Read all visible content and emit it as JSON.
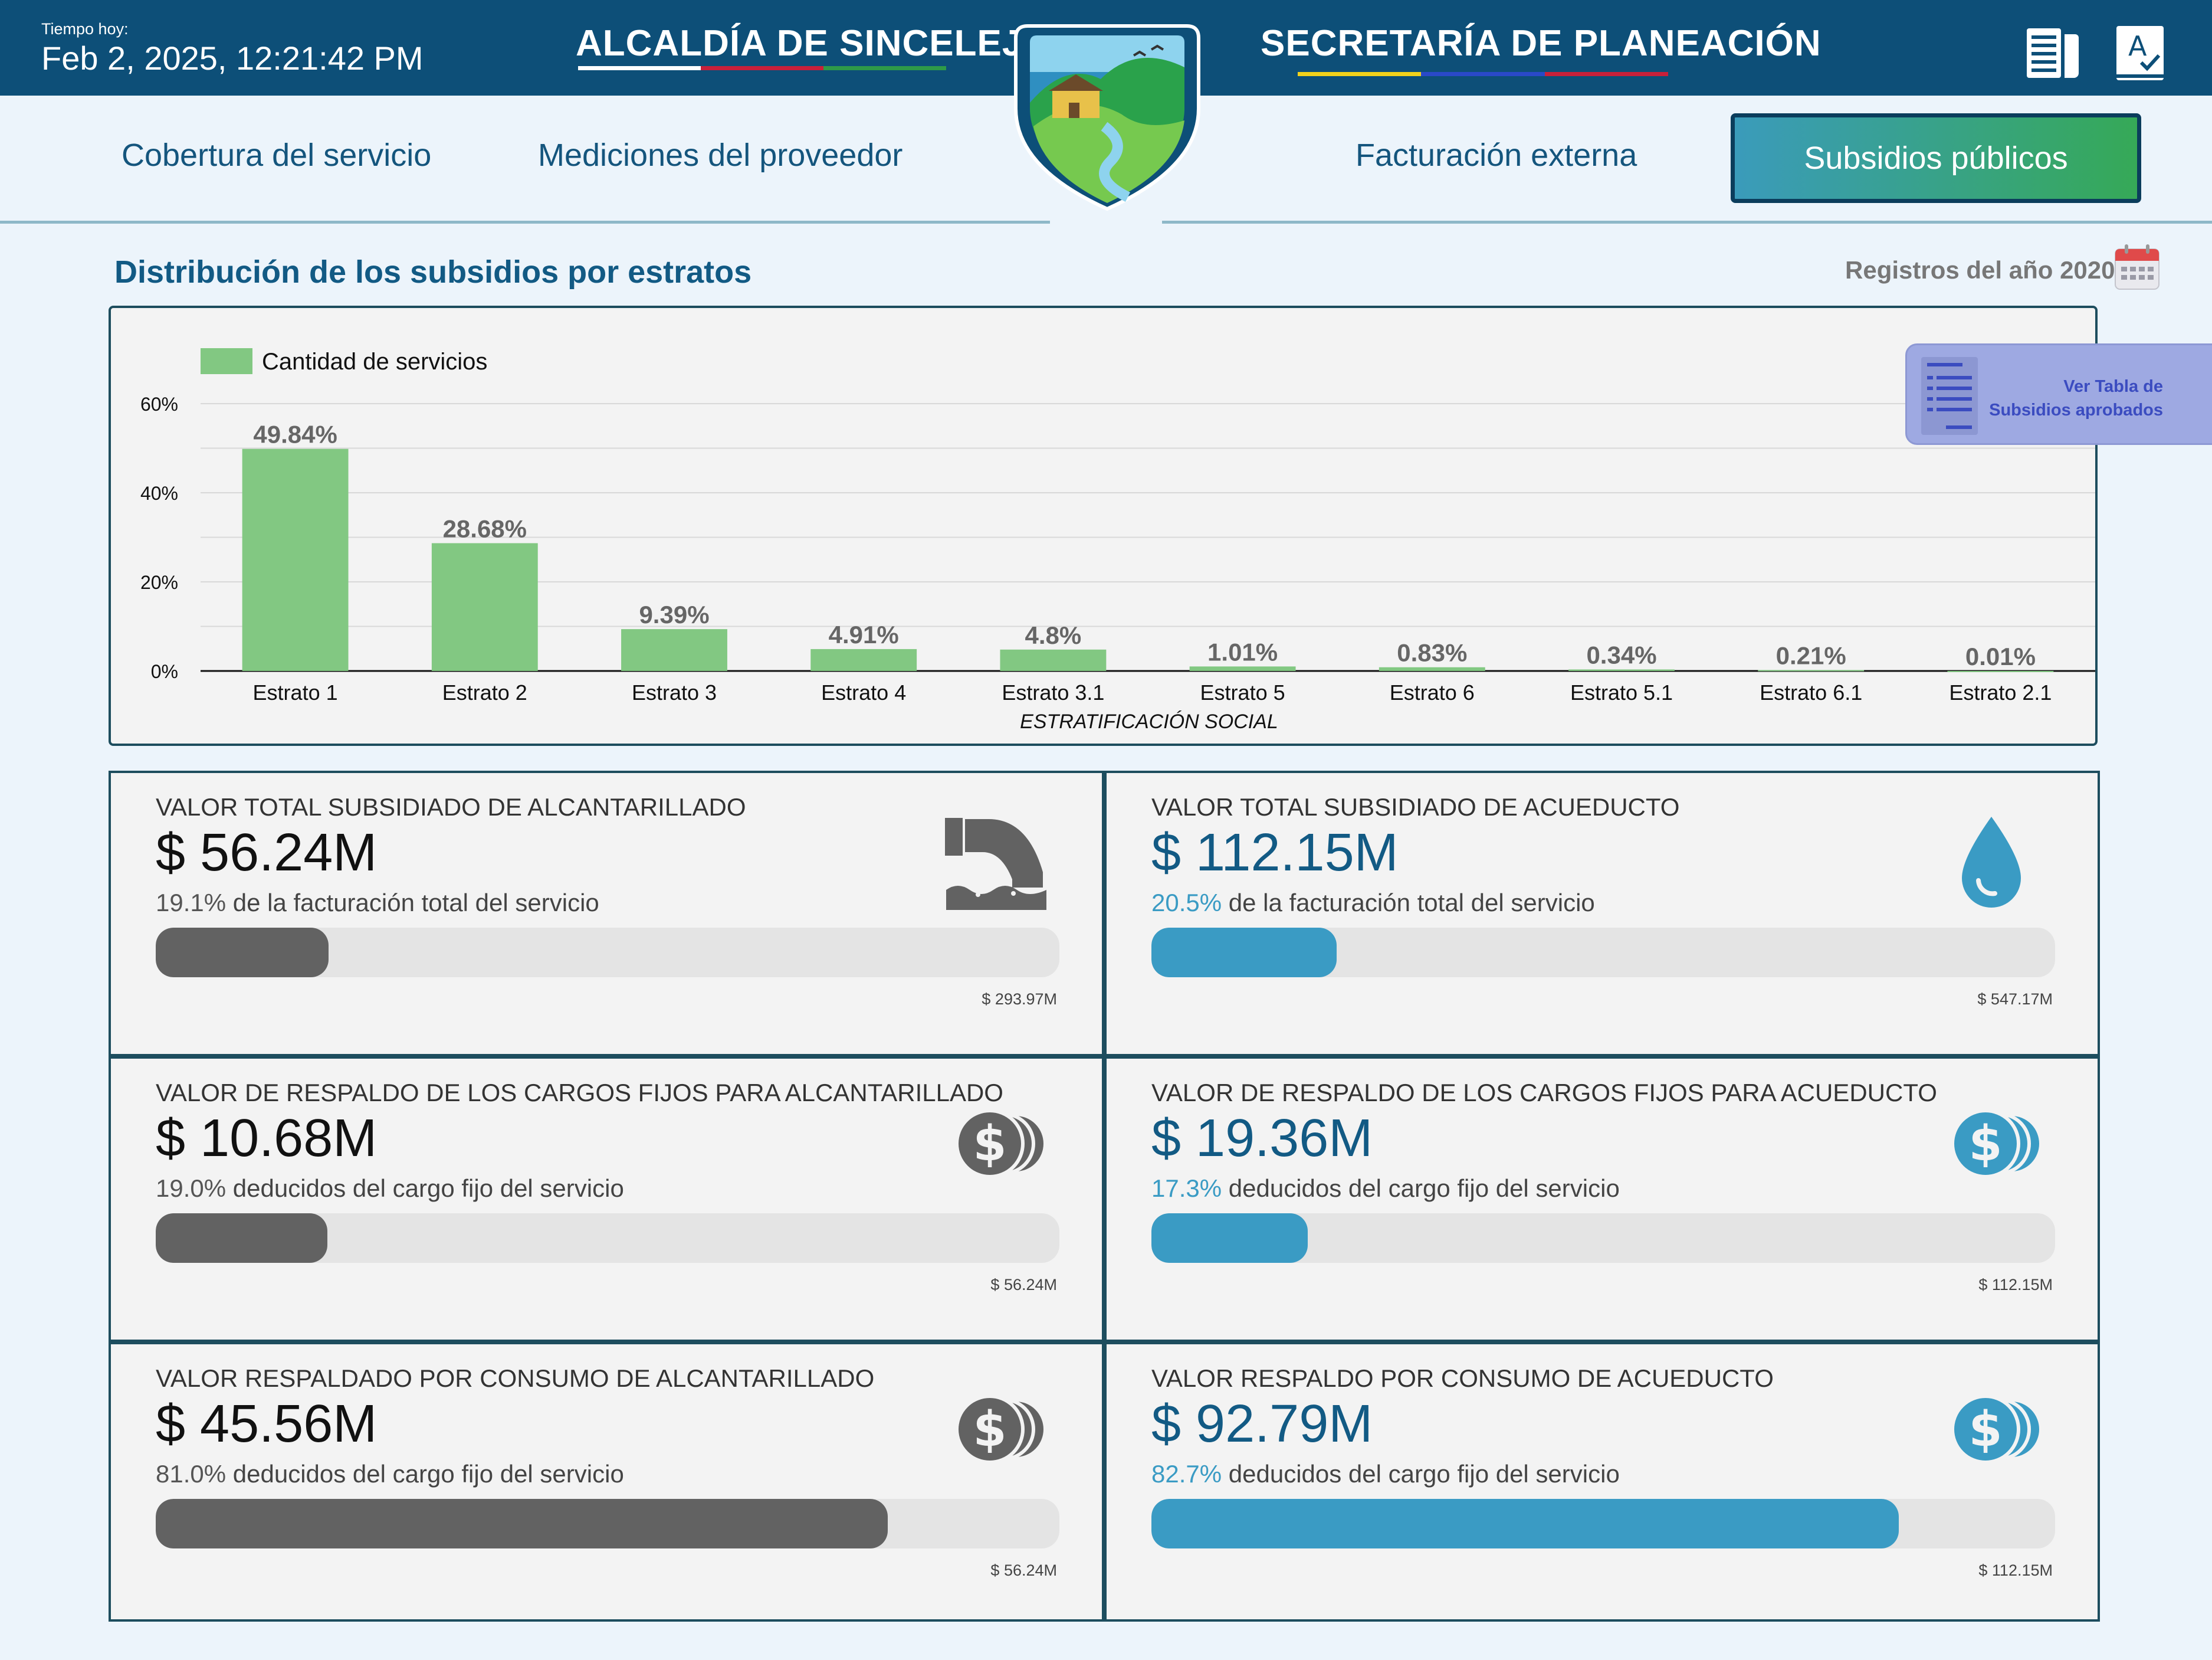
{
  "header": {
    "time_label": "Tiempo hoy:",
    "time_value": "Feb 2, 2025, 12:21:42 PM",
    "left_title": "ALCALDÍA DE SINCELEJO",
    "right_title": "SECRETARÍA DE PLANEACIÓN",
    "icons": [
      "book-icon",
      "spell-check-icon"
    ],
    "colors": {
      "bar": "#0d4f78"
    }
  },
  "nav": {
    "tabs": [
      {
        "label": "Cobertura del servicio"
      },
      {
        "label": "Mediciones del proveedor"
      },
      {
        "label": "Facturación externa"
      },
      {
        "label": "Subsidios públicos",
        "active": true
      }
    ]
  },
  "section": {
    "title": "Distribución de los subsidios por estratos",
    "year_label": "Registros del año 2020"
  },
  "tabla_button": {
    "line1": "Ver Tabla de",
    "line2": "Subsidios aprobados"
  },
  "chart_data": {
    "type": "bar",
    "series": [
      {
        "name": "Cantidad de servicios",
        "values": [
          49.84,
          28.68,
          9.39,
          4.91,
          4.8,
          1.01,
          0.83,
          0.34,
          0.21,
          0.01
        ],
        "color": "#82c882"
      }
    ],
    "categories": [
      "Estrato 1",
      "Estrato 2",
      "Estrato 3",
      "Estrato 4",
      "Estrato 3.1",
      "Estrato 5",
      "Estrato 6",
      "Estrato 5.1",
      "Estrato 6.1",
      "Estrato 2.1"
    ],
    "data_labels": [
      "49.84%",
      "28.68%",
      "9.39%",
      "4.91%",
      "4.8%",
      "1.01%",
      "0.83%",
      "0.34%",
      "0.21%",
      "0.01%"
    ],
    "xlabel": "ESTRATIFICACIÓN SOCIAL",
    "ylabel": "",
    "yticks": [
      "0%",
      "20%",
      "40%",
      "60%"
    ],
    "ylim": [
      0,
      60
    ],
    "grid": true,
    "legend": "top-left"
  },
  "cards": [
    {
      "title": "VALOR TOTAL SUBSIDIADO DE ALCANTARILLADO",
      "value": "$ 56.24M",
      "pct": "19.1%",
      "desc": " de la facturación total del servicio",
      "total": "$ 293.97M",
      "progress": 0.191,
      "icon": "sewer-pipe-icon",
      "style": "gray"
    },
    {
      "title": "VALOR TOTAL SUBSIDIADO DE ACUEDUCTO",
      "value": "$ 112.15M",
      "pct": "20.5%",
      "desc": " de la facturación total del servicio",
      "total": "$ 547.17M",
      "progress": 0.205,
      "icon": "water-drop-icon",
      "style": "blue"
    },
    {
      "title": "VALOR DE RESPALDO DE LOS CARGOS FIJOS PARA ALCANTARILLADO",
      "value": "$ 10.68M",
      "pct": "19.0%",
      "desc": " deducidos del cargo fijo del servicio",
      "total": "$ 56.24M",
      "progress": 0.19,
      "icon": "coins-icon",
      "style": "gray"
    },
    {
      "title": "VALOR DE RESPALDO DE LOS CARGOS FIJOS PARA ACUEDUCTO",
      "value": "$ 19.36M",
      "pct": "17.3%",
      "desc": " deducidos del cargo fijo del servicio",
      "total": "$ 112.15M",
      "progress": 0.173,
      "icon": "coins-icon",
      "style": "blue"
    },
    {
      "title": "VALOR RESPALDADO POR CONSUMO DE ALCANTARILLADO",
      "value": "$ 45.56M",
      "pct": "81.0%",
      "desc": " deducidos del cargo fijo del servicio",
      "total": "$ 56.24M",
      "progress": 0.81,
      "icon": "coins-icon",
      "style": "gray"
    },
    {
      "title": "VALOR RESPALDO POR CONSUMO DE ACUEDUCTO",
      "value": "$ 92.79M",
      "pct": "82.7%",
      "desc": " deducidos del cargo fijo del servicio",
      "total": "$ 112.15M",
      "progress": 0.827,
      "icon": "coins-icon",
      "style": "blue"
    }
  ]
}
